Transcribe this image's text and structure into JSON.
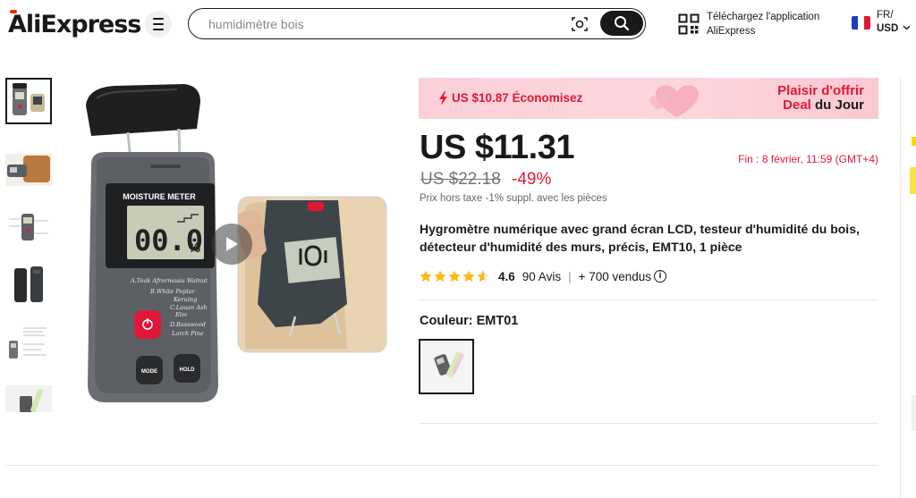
{
  "header": {
    "logo": "AliExpress",
    "search": {
      "value": "",
      "placeholder": "humidimètre bois"
    },
    "app_line1": "Téléchargez l'application",
    "app_line2": "AliExpress",
    "locale_lang": "FR/",
    "locale_currency": "USD"
  },
  "promo": {
    "saving": "US $10.87 Économisez",
    "deal_line1": "Plaisir d'offrir",
    "deal_line2_a": "Deal",
    "deal_line2_b": " du Jour"
  },
  "product": {
    "price": "US $11.31",
    "end_time": "Fin :  8 février, 11:59 (GMT+4)",
    "old_price": "US $22.18",
    "discount": "-49%",
    "tax_note": "Prix hors taxe -1% suppl. avec les pièces",
    "title": "Hygromètre numérique avec grand écran LCD, testeur d'humidité du bois, détecteur d'humidité des murs, précis, EMT10, 1 pièce",
    "rating": "4.6",
    "stars": 4.6,
    "reviews": "90 Avis",
    "separator": "|",
    "sold": "+ 700 vendus",
    "color_label": "Couleur: EMT01"
  },
  "device": {
    "label": "MOISTURE METER",
    "reading": "00.0",
    "unit": "%",
    "wood_lines": [
      "A.Teak Afrormosia Walnut",
      "B.White Poplar",
      "Keruing",
      "C.Lauan Ash",
      "Elm",
      "D.Basswood",
      "Larch Pine"
    ],
    "mode": "MODE",
    "hold": "HOLD"
  },
  "colors": {
    "accent": "#e01837",
    "promo_bg": "#fcd6dd",
    "star": "#fdb913",
    "text": "#191919"
  }
}
